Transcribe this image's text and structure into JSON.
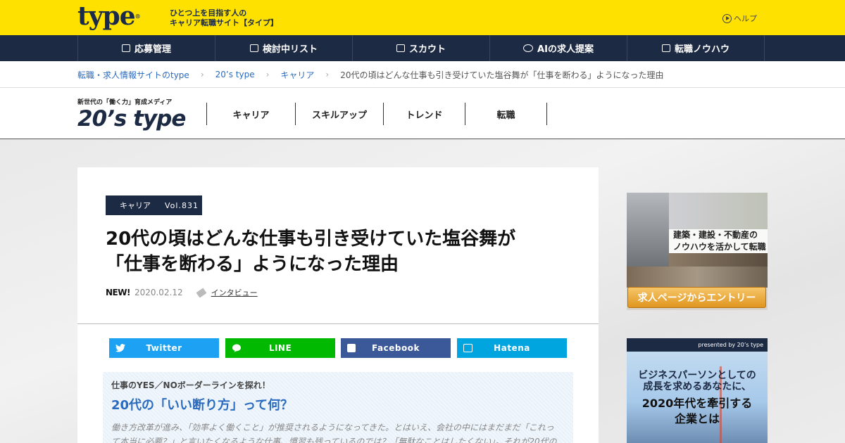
{
  "header": {
    "logo": "type",
    "logo_mark": "®",
    "tagline_line1": "ひとつ上を目指す人の",
    "tagline_line2": "キャリア転職サイト【タイプ】",
    "help_label": "ヘルプ"
  },
  "nav": [
    {
      "label": "応募管理",
      "icon": "document-icon"
    },
    {
      "label": "検討中リスト",
      "icon": "tag-icon"
    },
    {
      "label": "スカウト",
      "icon": "mail-icon"
    },
    {
      "label": "AIの求人提案",
      "icon": "robot-icon"
    },
    {
      "label": "転職ノウハウ",
      "icon": "book-icon"
    }
  ],
  "breadcrumb": {
    "items": [
      "転職・求人情報サイトのtype",
      "20’s type",
      "キャリア"
    ],
    "current": "20代の頃はどんな仕事も引き受けていた塩谷舞が「仕事を断わる」ようになった理由"
  },
  "media": {
    "sub": "新世代の「働く力」育成メディア",
    "logo": "20’s type",
    "nav": [
      "キャリア",
      "スキルアップ",
      "トレンド",
      "転職"
    ]
  },
  "article": {
    "category": "キャリア",
    "vol": "Vol.831",
    "title_line1": "20代の頃はどんな仕事も引き受けていた塩谷舞が",
    "title_line2": "「仕事を断わる」ようになった理由",
    "new_label": "NEW!",
    "date": "2020.02.12",
    "tag": "インタビュー"
  },
  "share": {
    "twitter": "Twitter",
    "line": "LINE",
    "facebook": "Facebook",
    "hatena": "Hatena",
    "colors": {
      "twitter": "#1da1f2",
      "line": "#00b900",
      "facebook": "#3b5998",
      "hatena": "#00a4de"
    }
  },
  "lead": {
    "kicker": "仕事のYES／NOボーダーラインを探れ！",
    "heading": "20代の「いい断り方」って何？",
    "body_line1": "働き方改革が進み、「効率よく働くこと」が推奨されるようになってきた。とはいえ、会社の中にはまだまだ「これっ",
    "body_line2": "て本当に必要？」と言いたくなるような仕事、慣習も残っているのでは？「無駄なことはしたくない」。それが20代の"
  },
  "ads": {
    "ad1_text_line1": "建築・建設・不動産の",
    "ad1_text_line2": "ノウハウを活かして転職",
    "ad1_button": "求人ページからエントリー",
    "ad2_top": "presented by 20’s type",
    "ad2_line1": "ビジネスパーソンとしての",
    "ad2_line2": "成長を求めるあなたに、",
    "ad2_line3": "2020年代を牽引する",
    "ad2_line4": "企業とは"
  }
}
